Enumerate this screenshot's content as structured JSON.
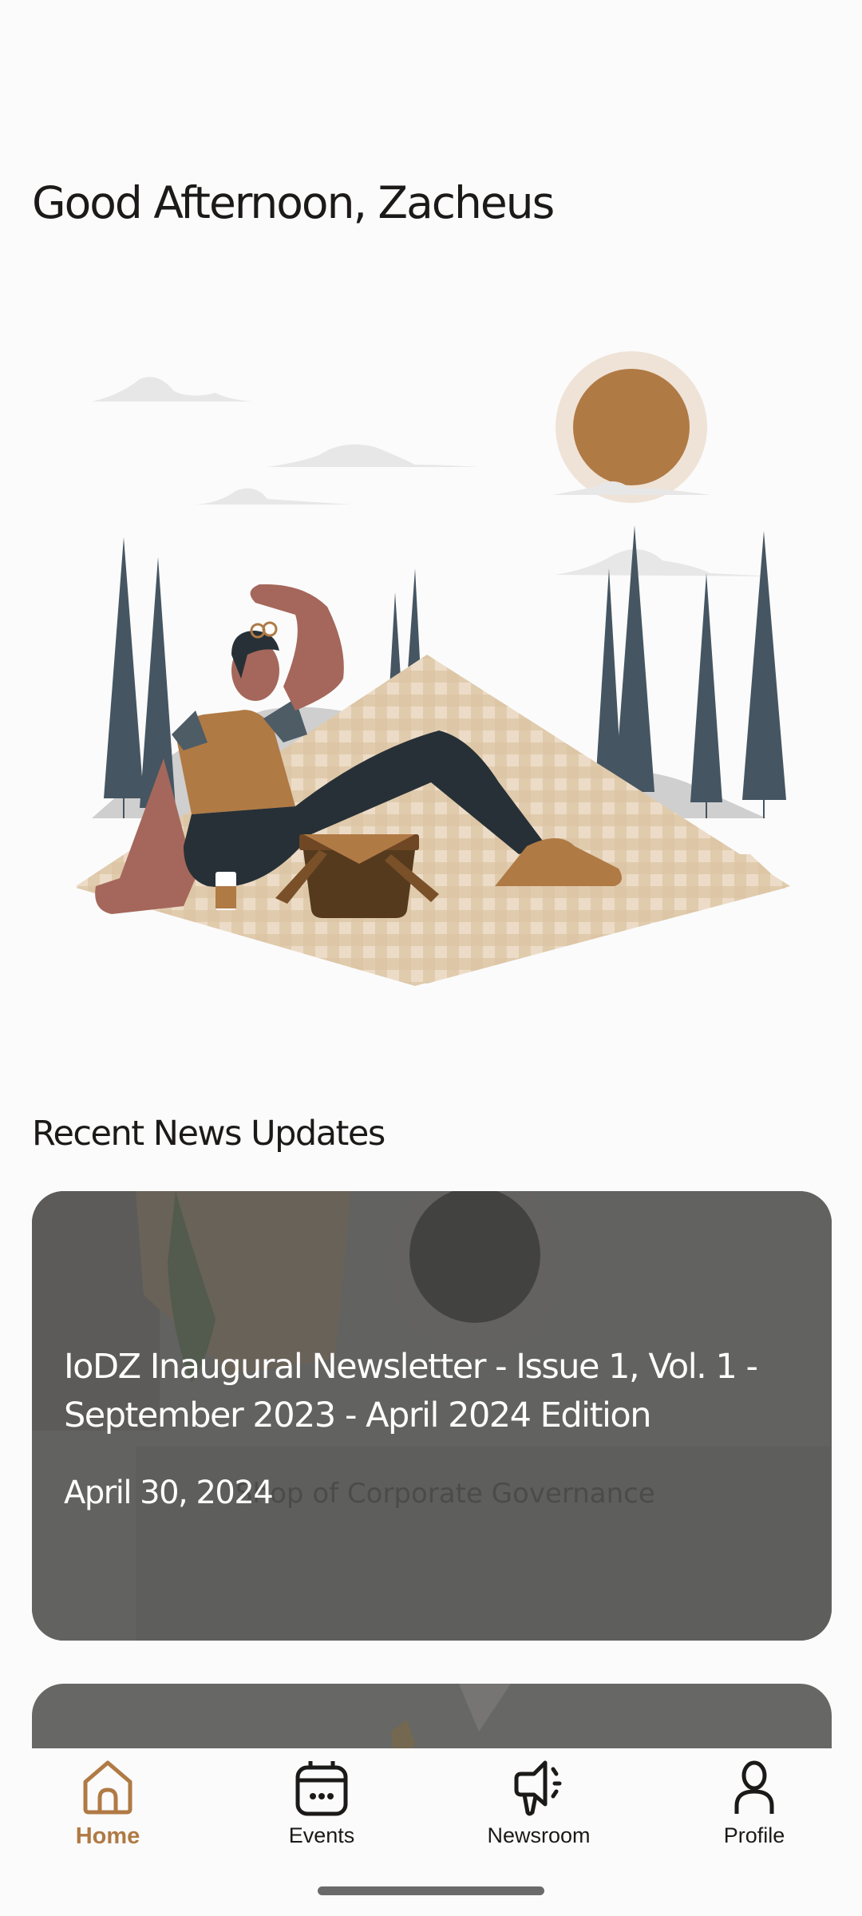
{
  "greeting": "Good Afternoon, Zacheus",
  "illustration": {
    "description": "Person relaxing on picnic blanket shading eyes from the sun",
    "colors": {
      "accent": "#b07a45",
      "sun_halo": "#efe3d7",
      "skin": "#a5675b",
      "pants": "#273036",
      "tree": "#455561",
      "blanket": "#e6cfb1"
    }
  },
  "recent_news": {
    "title": "Recent News Updates",
    "items": [
      {
        "title": "IoDZ Inaugural Newsletter - Issue 1, Vol. 1 - September 2023 - April 2024 Edition",
        "date": "April 30, 2024",
        "background_text": "Shop of Corporate Governance"
      },
      {
        "title": "",
        "date": ""
      }
    ]
  },
  "bottom_nav": {
    "active": "Home",
    "items": [
      {
        "label": "Home",
        "icon": "home-icon"
      },
      {
        "label": "Events",
        "icon": "calendar-icon"
      },
      {
        "label": "Newsroom",
        "icon": "megaphone-icon"
      },
      {
        "label": "Profile",
        "icon": "user-icon"
      }
    ],
    "active_color": "#b07a45"
  }
}
